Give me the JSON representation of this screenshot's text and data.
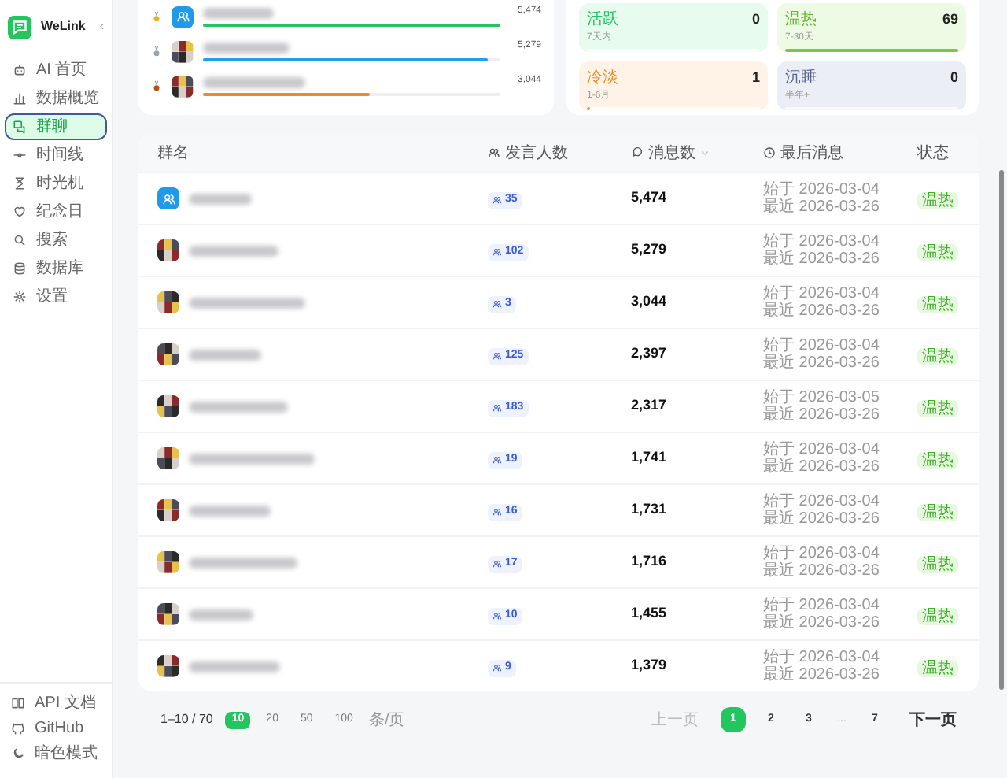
{
  "sidebar": {
    "app_name": "WeLink",
    "collapse": "‹",
    "items": [
      {
        "label": "AI 首页",
        "selected": false
      },
      {
        "label": "数据概览",
        "selected": false
      },
      {
        "label": "群聊",
        "selected": true
      },
      {
        "label": "时间线",
        "selected": false
      },
      {
        "label": "时光机",
        "selected": false
      },
      {
        "label": "纪念日",
        "selected": false
      },
      {
        "label": "搜索",
        "selected": false
      },
      {
        "label": "数据库",
        "selected": false
      },
      {
        "label": "设置",
        "selected": false
      }
    ],
    "footer": [
      {
        "label": "API 文档"
      },
      {
        "label": "GitHub"
      },
      {
        "label": "暗色模式"
      }
    ]
  },
  "ranking": [
    {
      "kind": "icon",
      "level": 1.0,
      "color": "#22c55e",
      "value": "5,474"
    },
    {
      "kind": "picture",
      "level": 0.96,
      "color": "#1ea1e8",
      "value": "5,279"
    },
    {
      "kind": "picture",
      "level": 0.56,
      "color": "#f08c1e",
      "value": "3,044"
    }
  ],
  "activity": [
    {
      "label": "活跃",
      "range": "7天内",
      "count": "0",
      "level": 0,
      "kind": "green"
    },
    {
      "label": "温热",
      "range": "7-30天",
      "count": "69",
      "level": 1.0,
      "kind": "lime"
    },
    {
      "label": "冷淡",
      "range": "1-6月",
      "count": "1",
      "level": 0.02,
      "kind": "orange"
    },
    {
      "label": "沉睡",
      "range": "半年+",
      "count": "0",
      "level": 0,
      "kind": "slate"
    }
  ],
  "table": {
    "columns": [
      "群名",
      "发言人数",
      "消息数",
      "最后消息",
      "状态"
    ],
    "rows": [
      {
        "kind": "icon",
        "members": "35",
        "messages": "5,474",
        "first": "始于 2026-03-04",
        "last": "最近 2026-03-26",
        "status": "温热"
      },
      {
        "kind": "picture",
        "members": "102",
        "messages": "5,279",
        "first": "始于 2026-03-04",
        "last": "最近 2026-03-26",
        "status": "温热"
      },
      {
        "kind": "picture",
        "members": "3",
        "messages": "3,044",
        "first": "始于 2026-03-04",
        "last": "最近 2026-03-26",
        "status": "温热"
      },
      {
        "kind": "picture",
        "members": "125",
        "messages": "2,397",
        "first": "始于 2026-03-04",
        "last": "最近 2026-03-26",
        "status": "温热"
      },
      {
        "kind": "picture",
        "members": "183",
        "messages": "2,317",
        "first": "始于 2026-03-05",
        "last": "最近 2026-03-26",
        "status": "温热"
      },
      {
        "kind": "picture",
        "members": "19",
        "messages": "1,741",
        "first": "始于 2026-03-04",
        "last": "最近 2026-03-26",
        "status": "温热"
      },
      {
        "kind": "picture",
        "members": "16",
        "messages": "1,731",
        "first": "始于 2026-03-04",
        "last": "最近 2026-03-26",
        "status": "温热"
      },
      {
        "kind": "picture",
        "members": "17",
        "messages": "1,716",
        "first": "始于 2026-03-04",
        "last": "最近 2026-03-26",
        "status": "温热"
      },
      {
        "kind": "picture",
        "members": "10",
        "messages": "1,455",
        "first": "始于 2026-03-04",
        "last": "最近 2026-03-26",
        "status": "温热"
      },
      {
        "kind": "picture",
        "members": "9",
        "messages": "1,379",
        "first": "始于 2026-03-04",
        "last": "最近 2026-03-26",
        "status": "温热"
      }
    ]
  },
  "pagination": {
    "range": "1–10 / 70",
    "sizes": [
      {
        "label": "10",
        "selected": true
      },
      {
        "label": "20",
        "selected": false
      },
      {
        "label": "50",
        "selected": false
      },
      {
        "label": "100",
        "selected": false
      }
    ],
    "per_page": "条/页",
    "prev": {
      "label": "上一页",
      "disabled": true
    },
    "pages": [
      {
        "label": "1",
        "selected": true,
        "kind": "page"
      },
      {
        "label": "2",
        "selected": false,
        "kind": "page"
      },
      {
        "label": "3",
        "selected": false,
        "kind": "page"
      },
      {
        "label": "...",
        "kind": "ellipsis"
      },
      {
        "label": "7",
        "selected": false,
        "kind": "page"
      }
    ],
    "next": {
      "label": "下一页",
      "disabled": false
    }
  }
}
